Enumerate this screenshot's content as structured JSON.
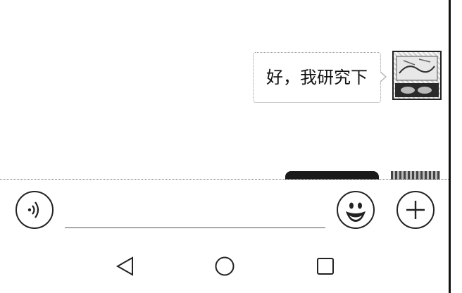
{
  "chat": {
    "messages": [
      {
        "sender": "me",
        "text": "好，我研究下"
      }
    ]
  },
  "input_bar": {
    "voice_icon": "voice-wave-icon",
    "text_value": "",
    "emoji_icon": "smiley-face-icon",
    "plus_icon": "plus-icon"
  },
  "nav_bar": {
    "back_icon": "back-triangle-icon",
    "home_icon": "home-circle-icon",
    "recent_icon": "recent-square-icon"
  }
}
